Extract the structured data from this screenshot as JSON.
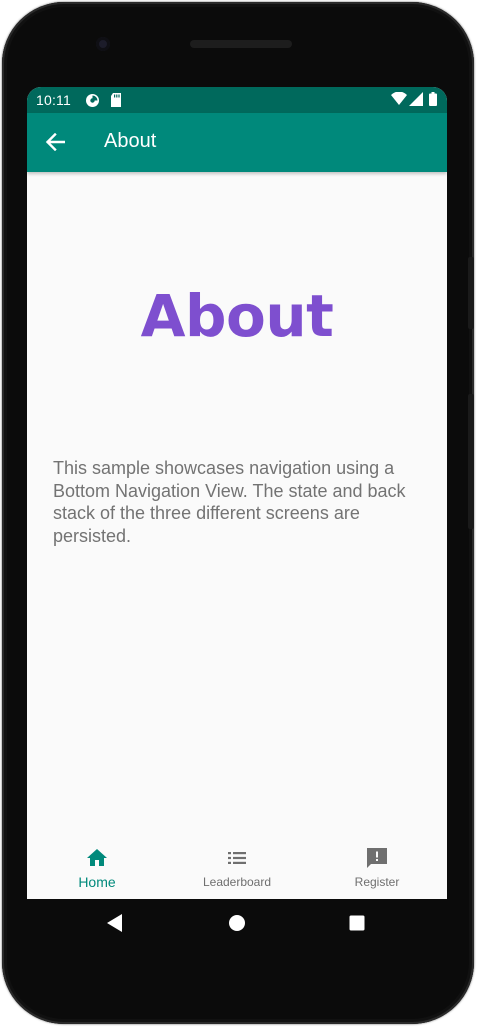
{
  "status_bar": {
    "time": "10:11"
  },
  "app_bar": {
    "title": "About"
  },
  "content": {
    "heading": "About",
    "description": "This sample showcases navigation using a Bottom Navigation View. The state and back stack of the three different screens are persisted."
  },
  "bottom_nav": {
    "items": [
      {
        "label": "Home",
        "icon": "home-icon",
        "active": true
      },
      {
        "label": "Leaderboard",
        "icon": "list-icon",
        "active": false
      },
      {
        "label": "Register",
        "icon": "feedback-icon",
        "active": false
      }
    ]
  },
  "colors": {
    "status_bar": "#00695c",
    "app_bar": "#00897b",
    "accent": "#00897b",
    "heading": "#7e4fcf",
    "body_text": "#737373",
    "background": "#fafafa"
  }
}
